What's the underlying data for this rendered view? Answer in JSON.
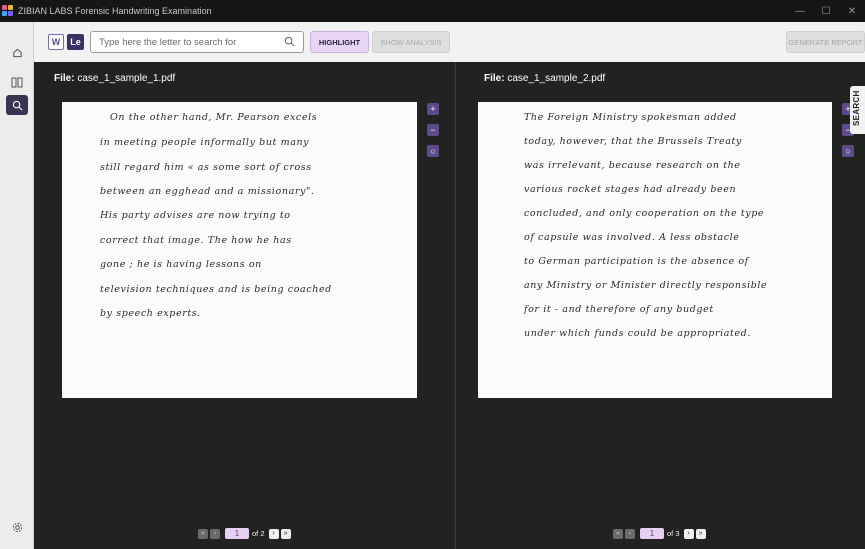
{
  "window": {
    "title": "ZIBIAN LABS Forensic Handwriting Examination",
    "controls": {
      "minimize": "—",
      "maximize": "☐",
      "close": "✕"
    }
  },
  "toolbar": {
    "mode_w": "W",
    "mode_le": "Le",
    "search_placeholder": "Type here the letter to search for",
    "highlight": "HIGHLIGHT",
    "show_analysis": "SHOW ANALYSIS",
    "generate_report": "GENERATE REPORT"
  },
  "sidebar": {
    "items": [
      "home-icon",
      "compare-icon",
      "search-icon"
    ],
    "active": "search-icon",
    "bottom": "settings-icon"
  },
  "left": {
    "file_label": "File:",
    "file_name": "case_1_sample_1.pdf",
    "lines": [
      "On the other hand, Mr. Pearson excels",
      "in meeting people informally but many",
      "still regard him « as some sort of cross",
      "between an egghead and a missionary\".",
      "His party advises are now trying to",
      "correct that image. The how he has",
      "gone ; he is having lessons on",
      "television techniques and is being coached",
      "by speech experts."
    ],
    "page_current": "1",
    "page_total": "of 2"
  },
  "right": {
    "file_label": "File:",
    "file_name": "case_1_sample_2.pdf",
    "lines": [
      "The Foreign Ministry spokesman added",
      "today, however, that the Brussels Treaty",
      "was irrelevant, because research on the",
      "various rocket stages had already been",
      "concluded, and only cooperation on the type",
      "of capsule was involved. A less obstacle",
      "to German participation is the absence of",
      "any Ministry or Minister directly responsible",
      "for it - and therefore of any budget",
      "under which funds could be appropriated."
    ],
    "page_current": "1",
    "page_total": "of 3"
  },
  "zoom": {
    "in": "+",
    "out": "−",
    "reset": "○"
  },
  "pager": {
    "first": "«",
    "prev": "‹",
    "next": "›",
    "last": "»"
  },
  "search_tab": "SEARCH",
  "colors": {
    "accent": "#5e4b8a",
    "active_nav": "#3b3354",
    "highlight_btn": "#e8d5f5",
    "panel_bg": "#222222"
  }
}
